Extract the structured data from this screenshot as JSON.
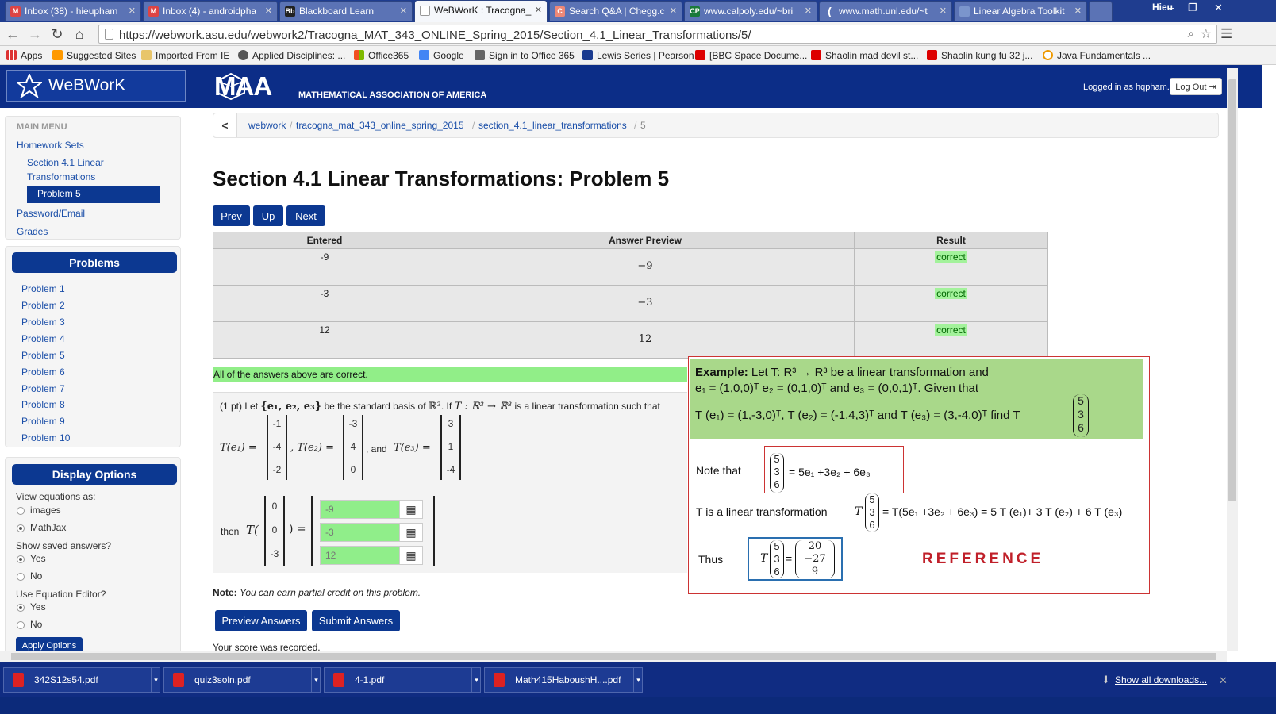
{
  "browser": {
    "tabs": [
      {
        "label": "Inbox (38) - hieupham",
        "icon": "M",
        "color": "#d44"
      },
      {
        "label": "Inbox (4) - androidpha",
        "icon": "M",
        "color": "#d44"
      },
      {
        "label": "Blackboard Learn",
        "icon": "Bb",
        "color": "#222"
      },
      {
        "label": "WeBWorK : Tracogna_",
        "icon": "W",
        "color": "#fff"
      },
      {
        "label": "Search Q&A | Chegg.c",
        "icon": "C",
        "color": "#e87"
      },
      {
        "label": "www.calpoly.edu/~bri",
        "icon": "CP",
        "color": "#1a7a3a"
      },
      {
        "label": "www.math.unl.edu/~t",
        "icon": "(",
        "color": "#3d5aa6"
      },
      {
        "label": "Linear Algebra Toolkit",
        "icon": "",
        "color": "#3d5aa6"
      }
    ],
    "window_user": "Hieu",
    "url": "https://webwork.asu.edu/webwork2/Tracogna_MAT_343_ONLINE_Spring_2015/Section_4.1_Linear_Transformations/5/",
    "bookmarks": [
      "Apps",
      "Suggested Sites",
      "Imported From IE",
      "Applied Disciplines: ...",
      "Office365",
      "Google",
      "Sign in to Office 365",
      "Lewis Series | Pearson",
      "[BBC Space Docume...",
      "Shaolin mad devil st...",
      "Shaolin kung fu 32 j...",
      "Java Fundamentals ..."
    ]
  },
  "header": {
    "logo": "WeBWorK",
    "maa": "MAA",
    "maa_sub": "MATHEMATICAL ASSOCIATION OF AMERICA",
    "logged_in": "Logged in as hqpham.",
    "logout": "Log Out"
  },
  "sidebar": {
    "main_menu": "MAIN MENU",
    "homework_sets": "Homework Sets",
    "section_line1": "Section 4.1 Linear",
    "section_line2": "Transformations",
    "current_problem": "Problem 5",
    "password": "Password/Email",
    "grades": "Grades",
    "problems_head": "Problems",
    "problems": [
      "Problem 1",
      "Problem 2",
      "Problem 3",
      "Problem 4",
      "Problem 5",
      "Problem 6",
      "Problem 7",
      "Problem 8",
      "Problem 9",
      "Problem 10"
    ],
    "display_head": "Display Options",
    "view_eq": "View equations as:",
    "opt_images": "images",
    "opt_mathjax": "MathJax",
    "show_saved": "Show saved answers?",
    "yes": "Yes",
    "no": "No",
    "use_editor": "Use Equation Editor?",
    "apply": "Apply Options"
  },
  "main": {
    "breadcrumb": [
      "webwork",
      "tracogna_mat_343_online_spring_2015",
      "section_4.1_linear_transformations",
      "5"
    ],
    "title": "Section 4.1 Linear Transformations: Problem 5",
    "nav": {
      "prev": "Prev",
      "up": "Up",
      "next": "Next"
    },
    "table": {
      "headers": [
        "Entered",
        "Answer Preview",
        "Result"
      ],
      "rows": [
        {
          "entered": "-9",
          "preview": "−9",
          "result": "correct"
        },
        {
          "entered": "-3",
          "preview": "−3",
          "result": "correct"
        },
        {
          "entered": "12",
          "preview": "12",
          "result": "correct"
        }
      ]
    },
    "all_correct": "All of the answers above are correct.",
    "problem": {
      "intro": "(1 pt) Let",
      "basis": "{e₁, e₂, e₃}",
      "mid": "be the standard basis of",
      "r3": "ℝ³",
      "if": ". If",
      "map": "T : ℝ³ → ℝ³",
      "tail": "is a linear transformation such that",
      "te1": "T(e₁) =",
      "te2": ", T(e₂) =",
      "and": ", and",
      "te3": "T(e₃) =",
      "m1": [
        "-1",
        "-4",
        "-2"
      ],
      "m2": [
        "-3",
        "4",
        "0"
      ],
      "m3": [
        "3",
        "1",
        "-4"
      ],
      "then": "then",
      "T": "T(",
      "close": ") =",
      "vec": [
        "0",
        "0",
        "-3"
      ],
      "answers": [
        "-9",
        "-3",
        "12"
      ]
    },
    "note_label": "Note:",
    "note": "You can earn partial credit on this problem.",
    "preview_btn": "Preview Answers",
    "submit_btn": "Submit Answers",
    "score": "Your score was recorded."
  },
  "overlay": {
    "ex_label": "Example:",
    "line1": "Let T: R³ → R³ be a linear transformation and",
    "line2": "e₁ = (1,0,0)ᵀ  e₂ = (0,1,0)ᵀ  and  e₃ = (0,0,1)ᵀ. Given that",
    "line3": "T (e₁) = (1,-3,0)ᵀ,  T (e₂) = (-1,4,3)ᵀ and  T (e₃) = (3,-4,0)ᵀ  find  T",
    "vec": [
      "5",
      "3",
      "6"
    ],
    "note_that": "Note that",
    "note_eq": "= 5e₁ +3e₂ + 6e₃",
    "linear": "T is a linear transformation",
    "linear_eq": "= T(5e₁ +3e₂ + 6e₃) = 5 T (e₁)+ 3 T (e₂) + 6 T (e₃)",
    "thus": "Thus",
    "result": [
      "20",
      "−27",
      "9"
    ],
    "reference": "REFERENCE"
  },
  "downloads": {
    "files": [
      "342S12s54.pdf",
      "quiz3soln.pdf",
      "4-1.pdf",
      "Math415HaboushH....pdf"
    ],
    "show_all": "Show all downloads..."
  }
}
